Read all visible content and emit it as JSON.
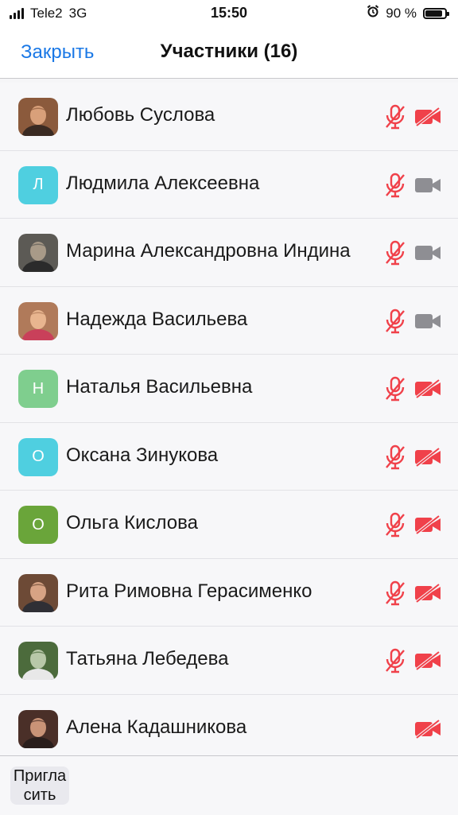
{
  "status_bar": {
    "carrier": "Tele2",
    "network": "3G",
    "time": "15:50",
    "battery_percent": "90 %",
    "battery_level": 0.9
  },
  "header": {
    "close_label": "Закрыть",
    "title": "Участники (16)"
  },
  "participants": [
    {
      "name": "Любовь Суслова",
      "avatar": "photo",
      "mic": "muted",
      "camera": "off"
    },
    {
      "name": "Людмила Алексеевна",
      "avatar": "letter",
      "initial": "Л",
      "avatar_color": "#4fcfe0",
      "mic": "muted",
      "camera": "on"
    },
    {
      "name": "Марина Александровна Индина",
      "avatar": "photo",
      "mic": "muted",
      "camera": "on"
    },
    {
      "name": "Надежда Васильева",
      "avatar": "photo",
      "mic": "muted",
      "camera": "on"
    },
    {
      "name": "Наталья Васильевна",
      "avatar": "letter",
      "initial": "Н",
      "avatar_color": "#7fce8e",
      "mic": "muted",
      "camera": "off"
    },
    {
      "name": "Оксана Зинукова",
      "avatar": "letter",
      "initial": "О",
      "avatar_color": "#4fcfe0",
      "mic": "muted",
      "camera": "off"
    },
    {
      "name": "Ольга Кислова",
      "avatar": "letter",
      "initial": "О",
      "avatar_color": "#6aa53a",
      "mic": "muted",
      "camera": "off"
    },
    {
      "name": "Рита Римовна Герасименко",
      "avatar": "photo",
      "mic": "muted",
      "camera": "off"
    },
    {
      "name": "Татьяна Лебедева",
      "avatar": "photo",
      "mic": "muted",
      "camera": "off"
    },
    {
      "name": "Алена Кадашникова",
      "avatar": "photo",
      "mic": "none",
      "camera": "off"
    }
  ],
  "footer": {
    "invite_label": "Пригласить"
  },
  "colors": {
    "accent": "#1a78e6",
    "muted_red": "#f0414a",
    "camera_gray": "#8e8e93"
  }
}
